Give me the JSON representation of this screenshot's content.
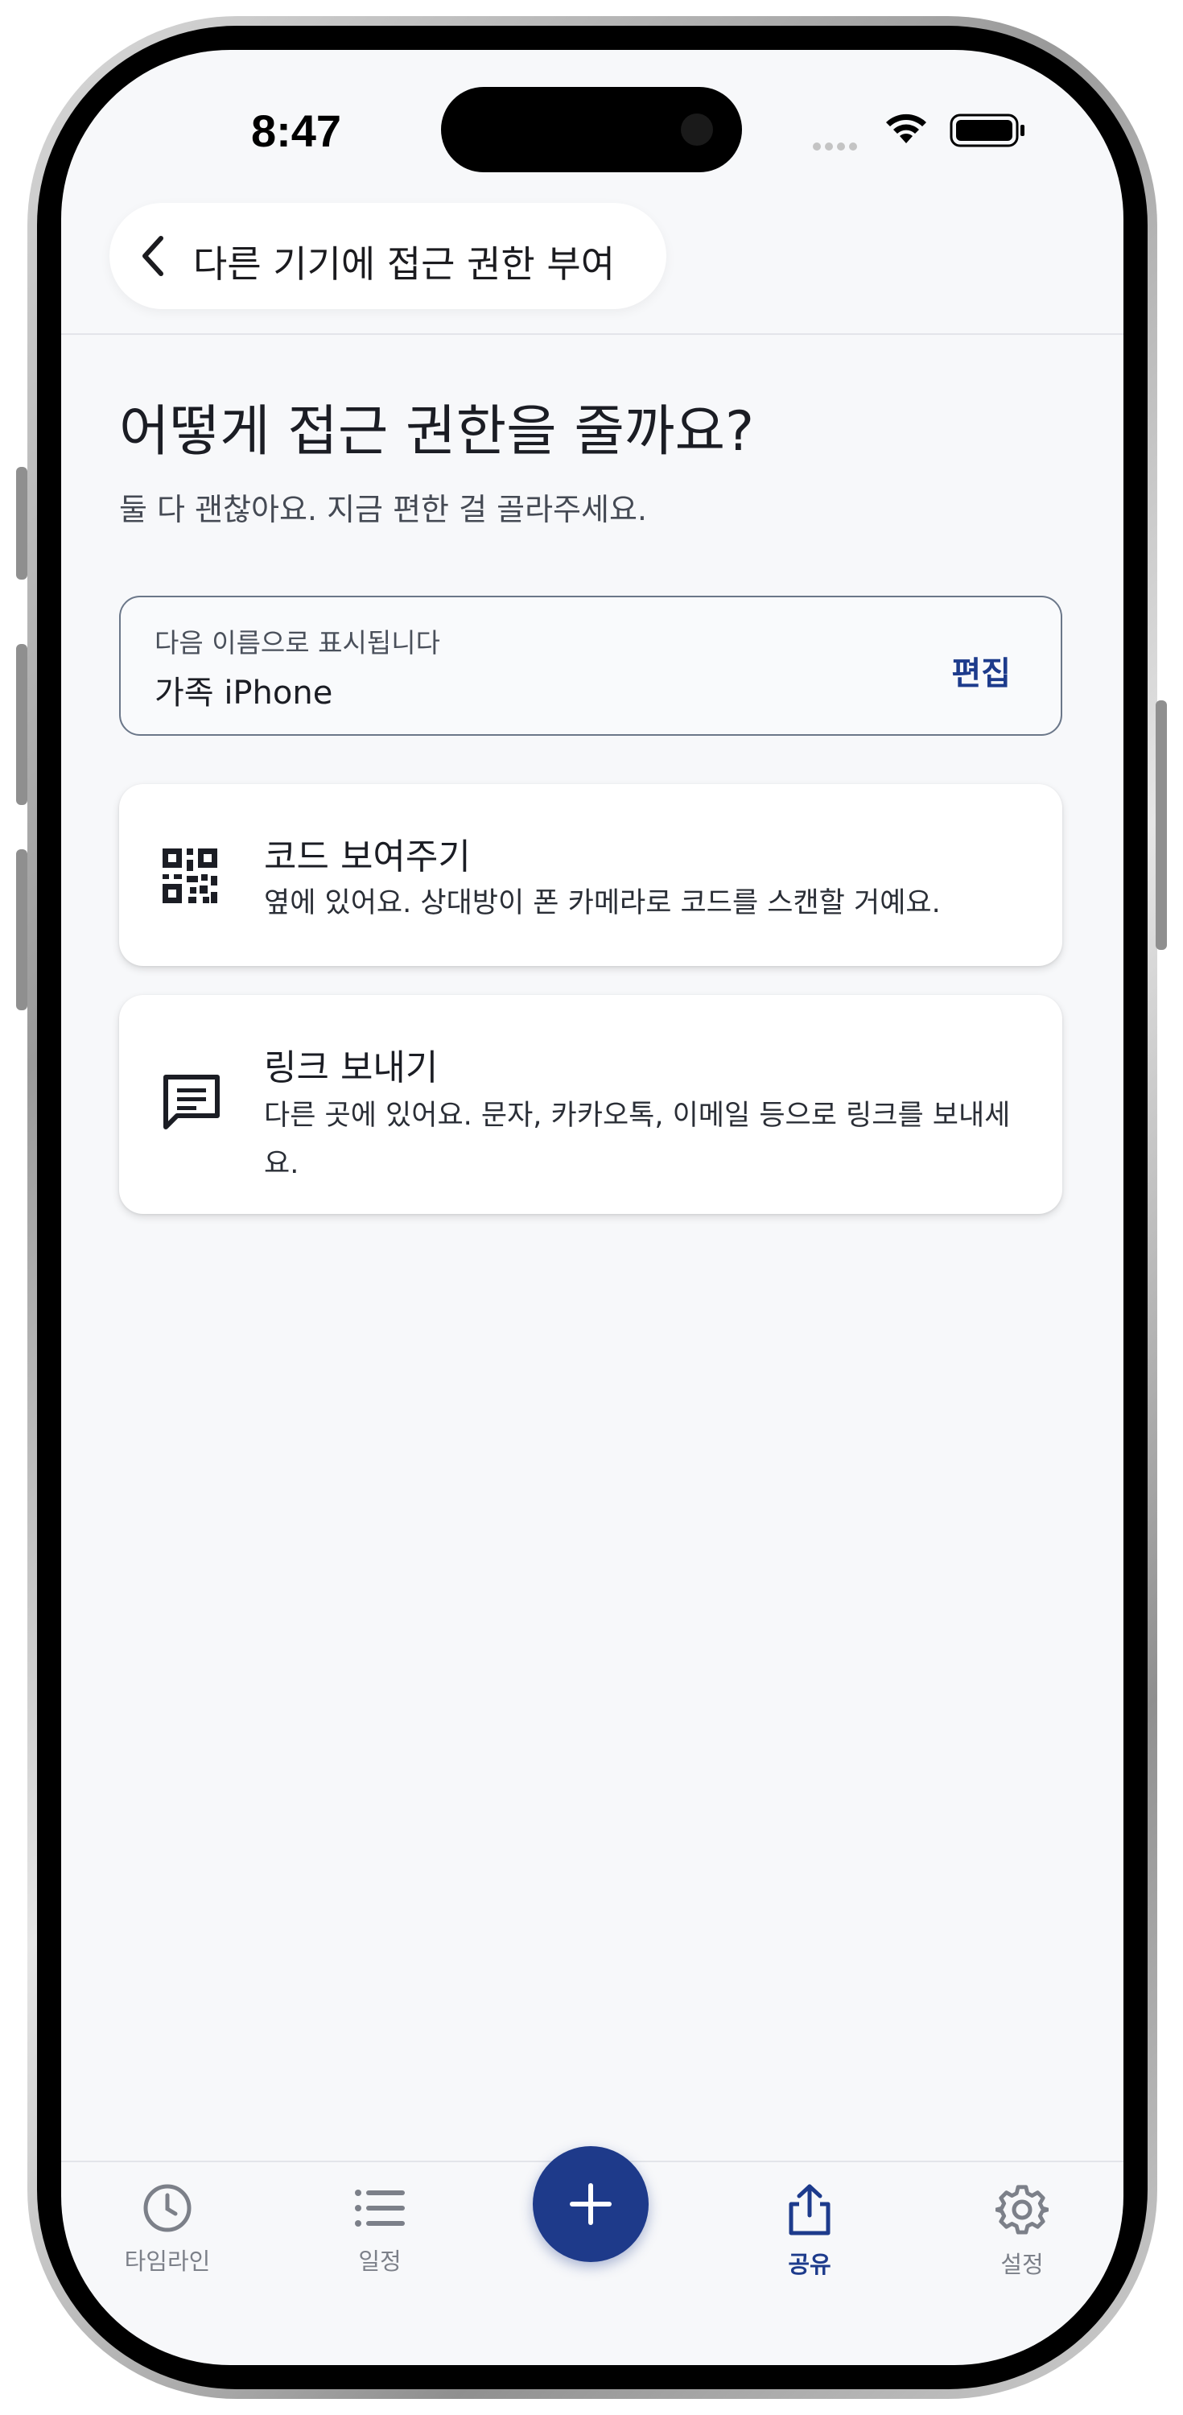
{
  "status_bar": {
    "time": "8:47",
    "icons": [
      "cellular-signal-icon",
      "wifi-icon",
      "battery-icon"
    ]
  },
  "header": {
    "back_icon": "chevron-left-icon",
    "title": "다른 기기에 접근 권한 부여"
  },
  "main": {
    "title": "어떻게 접근 권한을 줄까요?",
    "subtitle": "둘 다 괜찮아요. 지금 편한 걸 골라주세요.",
    "display_name": {
      "label": "다음 이름으로 표시됩니다",
      "value": "가족 iPhone",
      "edit_label": "편집"
    },
    "options": [
      {
        "icon": "qr-code-icon",
        "title": "코드 보여주기",
        "description": "옆에 있어요. 상대방이 폰 카메라로 코드를 스캔할 거예요."
      },
      {
        "icon": "message-icon",
        "title": "링크 보내기",
        "description": "다른 곳에 있어요. 문자, 카카오톡, 이메일 등으로 링크를 보내세요."
      }
    ]
  },
  "tab_bar": {
    "items": [
      {
        "label": "타임라인",
        "icon": "clock-icon",
        "active": false
      },
      {
        "label": "일정",
        "icon": "list-icon",
        "active": false
      },
      {
        "label": "공유",
        "icon": "share-icon",
        "active": true
      },
      {
        "label": "설정",
        "icon": "gear-icon",
        "active": false
      }
    ],
    "add_icon": "plus-icon"
  },
  "colors": {
    "accent": "#1e3a8a",
    "background": "#f7f8fa",
    "inactive_tab": "#7c8089"
  }
}
